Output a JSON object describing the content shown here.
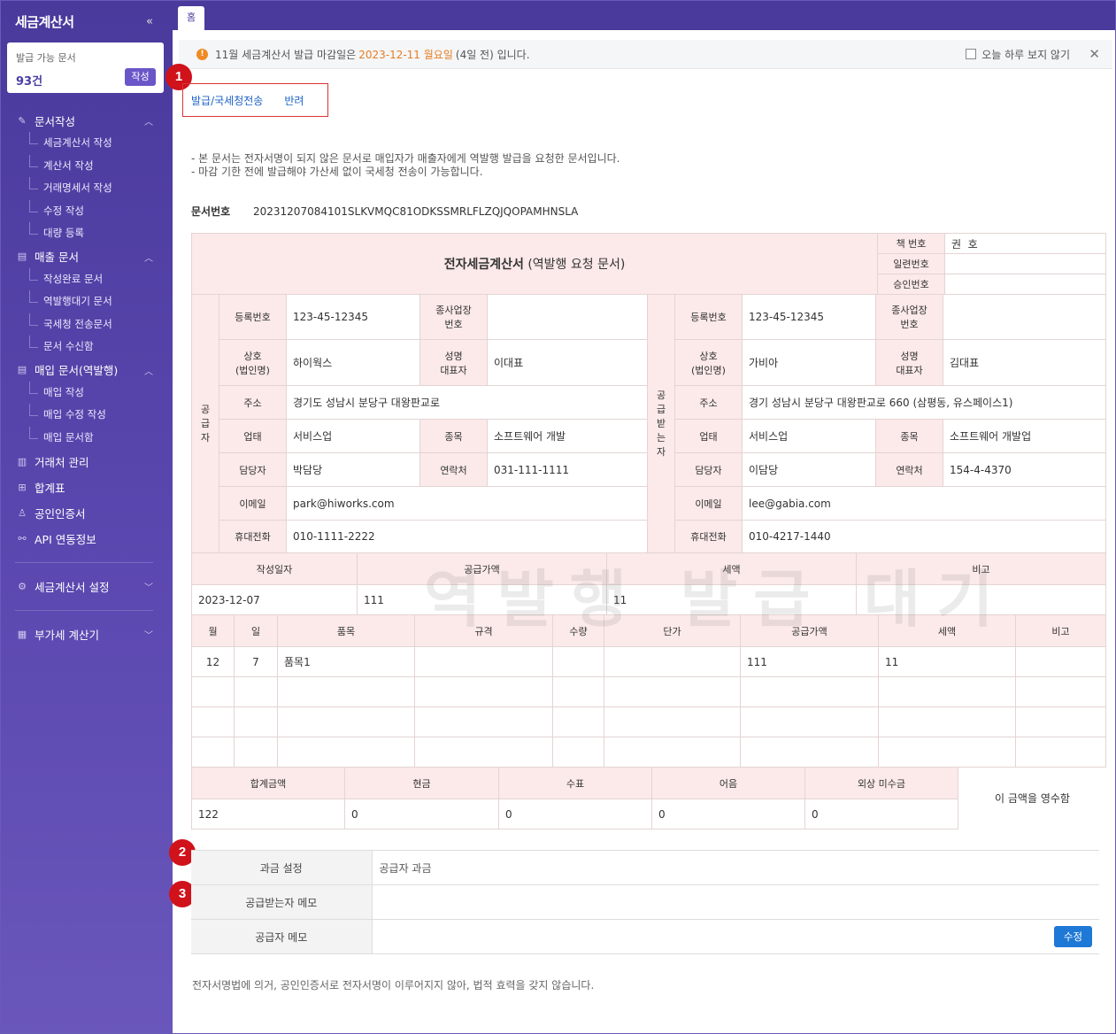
{
  "sidebar": {
    "title": "세금계산서",
    "collapse_icon": "double-chevron-left-icon",
    "card": {
      "label": "발급 가능 문서",
      "count": "93건",
      "button": "작성"
    },
    "groups": [
      {
        "label": "문서작성",
        "items": [
          "세금계산서 작성",
          "계산서 작성",
          "거래명세서 작성",
          "수정 작성",
          "대량 등록"
        ]
      },
      {
        "label": "매출 문서",
        "items": [
          "작성완료 문서",
          "역발행대기 문서",
          "국세청 전송문서",
          "문서 수신함"
        ]
      },
      {
        "label": "매입 문서(역발행)",
        "items": [
          "매입 작성",
          "매입 수정 작성",
          "매입 문서함"
        ]
      }
    ],
    "links": [
      "거래처 관리",
      "합계표",
      "공인인증서",
      "API 연동정보"
    ],
    "settings": "세금계산서 설정",
    "vat": "부가세 계산기"
  },
  "tabs": {
    "home": "홈"
  },
  "notice": {
    "text_before": "11월 세금계산서 발급 마감일은",
    "date": "2023-12-11 월요일",
    "text_after": "(4일 전) 입니다.",
    "hide_today": "오늘 하루 보지 않기"
  },
  "badges": [
    "1",
    "2",
    "3"
  ],
  "actions": {
    "issue": "발급/국세청전송",
    "reject": "반려"
  },
  "description": [
    "- 본 문서는 전자서명이 되지 않은 문서로 매입자가 매출자에게 역발행 발급을 요청한 문서입니다.",
    "- 마감 기한 전에 발급해야 가산세 없이 국세청 전송이 가능합니다."
  ],
  "doc": {
    "label": "문서번호",
    "number": "20231207084101SLKVMQC81ODKSSMRLFLZQJQOPAMHNSLA"
  },
  "invoice": {
    "title": "전자세금계산서",
    "subtitle": "(역발행 요청 문서)",
    "book_label": "책 번호",
    "book_value": "권  호",
    "serial_label": "일련번호",
    "approval_label": "승인번호",
    "supplier_side": "공급자",
    "receiver_side": "공급받는자",
    "labels": {
      "reg": "등록번호",
      "biz": "종사업장 번호",
      "company": "상호 (법인명)",
      "ceo": "성명 대표자",
      "addr": "주소",
      "type": "업태",
      "item": "종목",
      "manager": "담당자",
      "contact": "연락처",
      "email": "이메일",
      "mobile": "휴대전화"
    },
    "supplier": {
      "reg": "123-45-12345",
      "company": "하이웍스",
      "ceo": "이대표",
      "addr": "경기도 성남시 분당구 대왕판교로",
      "type": "서비스업",
      "item": "소프트웨어 개발",
      "manager": "박담당",
      "contact": "031-111-1111",
      "email": "park@hiworks.com",
      "mobile": "010-1111-2222"
    },
    "receiver": {
      "reg": "123-45-12345",
      "company": "가비아",
      "ceo": "김대표",
      "addr": "경기 성남시 분당구 대왕판교로 660 (삼평동, 유스페이스1)",
      "type": "서비스업",
      "item": "소프트웨어 개발업",
      "manager": "이담당",
      "contact": "154-4-4370",
      "email": "lee@gabia.com",
      "mobile": "010-4217-1440"
    },
    "summary_headers": [
      "작성일자",
      "공급가액",
      "세액",
      "비고"
    ],
    "summary_values": [
      "2023-12-07",
      "111",
      "11",
      ""
    ],
    "watermark": "역발행 발급 대기",
    "item_headers": [
      "월",
      "일",
      "품목",
      "규격",
      "수량",
      "단가",
      "공급가액",
      "세액",
      "비고"
    ],
    "items": [
      [
        "12",
        "7",
        "품목1",
        "",
        "",
        "",
        "111",
        "11",
        ""
      ]
    ],
    "total_headers": [
      "합계금액",
      "현금",
      "수표",
      "어음",
      "외상 미수금"
    ],
    "total_values": [
      "122",
      "0",
      "0",
      "0",
      "0"
    ],
    "receipt_note": "이 금액을 영수함"
  },
  "memo": {
    "charge_label": "과금 설정",
    "charge_value": "공급자 과금",
    "receiver_memo_label": "공급받는자 메모",
    "supplier_memo_label": "공급자 메모",
    "edit_button": "수정"
  },
  "footer": "전자서명법에 의거, 공인인증서로 전자서명이 이루어지지 않아, 법적 효력을 갖지 않습니다."
}
